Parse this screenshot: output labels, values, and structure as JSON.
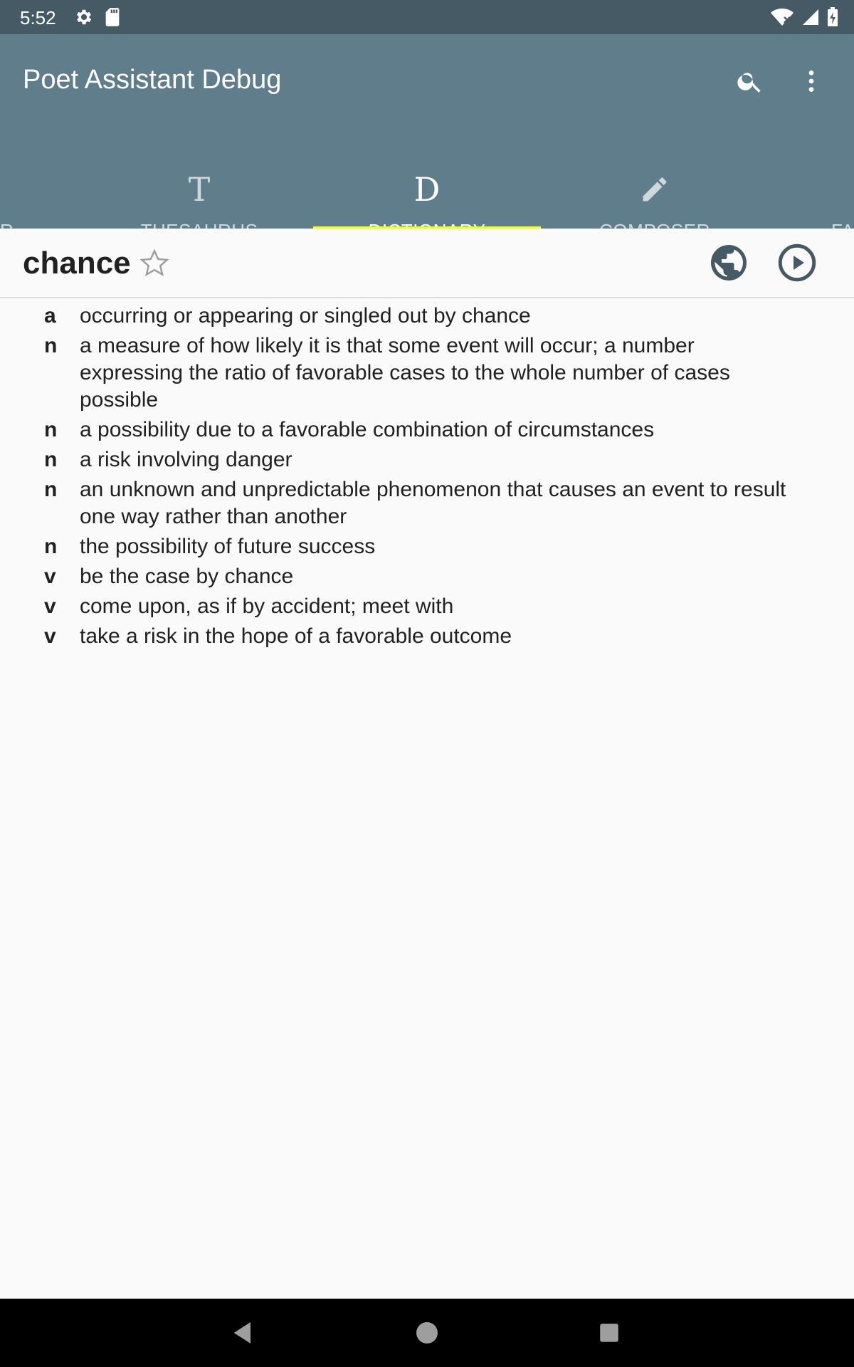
{
  "status_bar": {
    "time": "5:52",
    "left_icons": [
      "settings-icon",
      "sd-card-icon"
    ],
    "right_icons": [
      "wifi-off-icon",
      "signal-icon",
      "battery-charging-icon"
    ]
  },
  "app": {
    "title": "Poet Assistant Debug",
    "actions": [
      "search-icon",
      "more-vert-icon"
    ],
    "colors": {
      "toolbar": "#607D8B",
      "status_bar": "#455A64",
      "tab_indicator": "#EEFF41"
    }
  },
  "tabs": {
    "partial_left": "R",
    "items": [
      {
        "icon": "T",
        "label": "THESAURUS"
      },
      {
        "icon": "D",
        "label": "DICTIONARY",
        "active": true
      },
      {
        "icon": "pencil-icon",
        "label": "COMPOSER"
      }
    ],
    "partial_right": "FA"
  },
  "word": {
    "text": "chance",
    "favorite_icon": "star-outline-icon",
    "web_icon": "globe-icon",
    "play_icon": "play-circle-icon"
  },
  "definitions": [
    {
      "pos": "a",
      "text": "occurring or appearing or singled out by chance"
    },
    {
      "pos": "n",
      "text": "a measure of how likely it is that some event will occur; a number expressing the ratio of favorable cases to the whole number of cases possible"
    },
    {
      "pos": "n",
      "text": "a possibility due to a favorable combination of circumstances"
    },
    {
      "pos": "n",
      "text": "a risk involving danger"
    },
    {
      "pos": "n",
      "text": "an unknown and unpredictable phenomenon that causes an event to result one way rather than another"
    },
    {
      "pos": "n",
      "text": "the possibility of future success"
    },
    {
      "pos": "v",
      "text": "be the case by chance"
    },
    {
      "pos": "v",
      "text": "come upon, as if by accident; meet with"
    },
    {
      "pos": "v",
      "text": "take a risk in the hope of a favorable outcome"
    }
  ],
  "nav_bar": {
    "buttons": [
      "back-icon",
      "home-icon",
      "recents-icon"
    ]
  }
}
